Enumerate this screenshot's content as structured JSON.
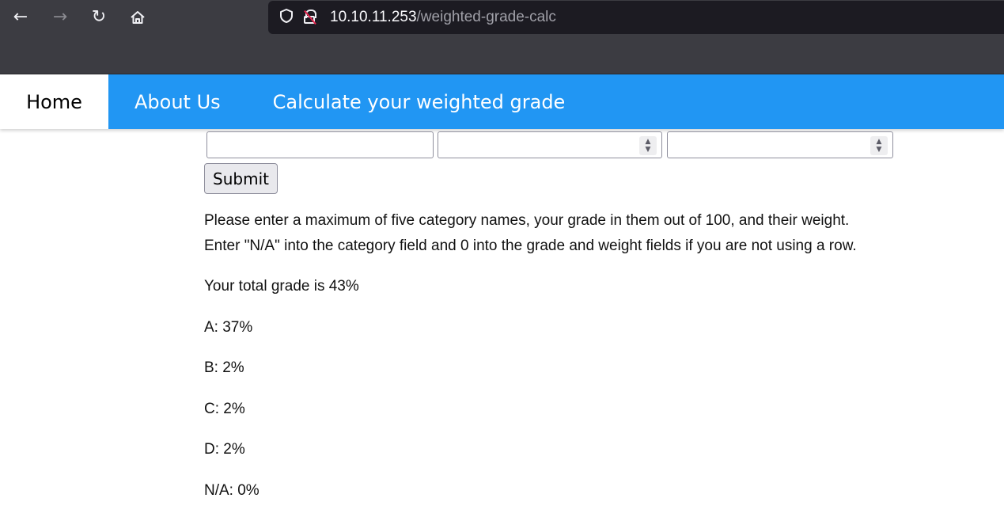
{
  "browser": {
    "url_host": "10.10.11.253",
    "url_path": "/weighted-grade-calc",
    "icons": {
      "back": "back-arrow-icon",
      "forward": "forward-arrow-icon",
      "reload": "reload-icon",
      "home": "home-icon",
      "shield": "shield-icon",
      "lock": "insecure-lock-icon"
    }
  },
  "navbar": {
    "accent_color": "#2196f3",
    "items": [
      {
        "label": "Home",
        "active": true
      },
      {
        "label": "About Us",
        "active": false
      },
      {
        "label": "Calculate your weighted grade",
        "active": false
      }
    ]
  },
  "form": {
    "category_value": "",
    "grade_value": "",
    "weight_value": "",
    "submit_label": "Submit"
  },
  "instructions": {
    "line1": "Please enter a maximum of five category names, your grade in them out of 100, and their weight.",
    "line2": "Enter \"N/A\" into the category field and 0 into the grade and weight fields if you are not using a row."
  },
  "results": {
    "total": "Your total grade is 43%",
    "rows": [
      "A: 37%",
      "B: 2%",
      "C: 2%",
      "D: 2%",
      "N/A: 0%"
    ]
  }
}
